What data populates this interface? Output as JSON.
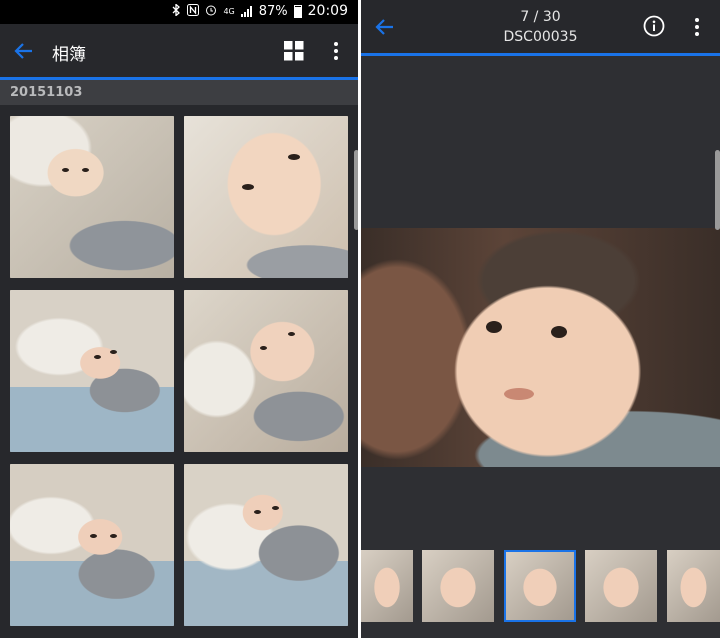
{
  "status_bar": {
    "icons": [
      "bluetooth-icon",
      "nfc-icon",
      "alarm-icon",
      "lte-icon",
      "signal-icon",
      "battery-icon"
    ],
    "network_label": "4G",
    "battery_text": "87%",
    "time": "20:09"
  },
  "album_screen": {
    "title": "相簿",
    "back_icon": "back-arrow-icon",
    "actions": [
      "grid-view-icon",
      "more-options-icon"
    ],
    "section_date": "20151103",
    "thumbnail_count": 6
  },
  "viewer_screen": {
    "counter": "7 / 30",
    "filename": "DSC00035",
    "actions": [
      "info-icon",
      "more-options-icon"
    ],
    "filmstrip_selected": 3
  },
  "colors": {
    "accent": "#1a73e8",
    "app_bar_bg": "#27282c",
    "section_header_bg": "#3d3e42",
    "viewer_bg": "#2e2f33"
  }
}
